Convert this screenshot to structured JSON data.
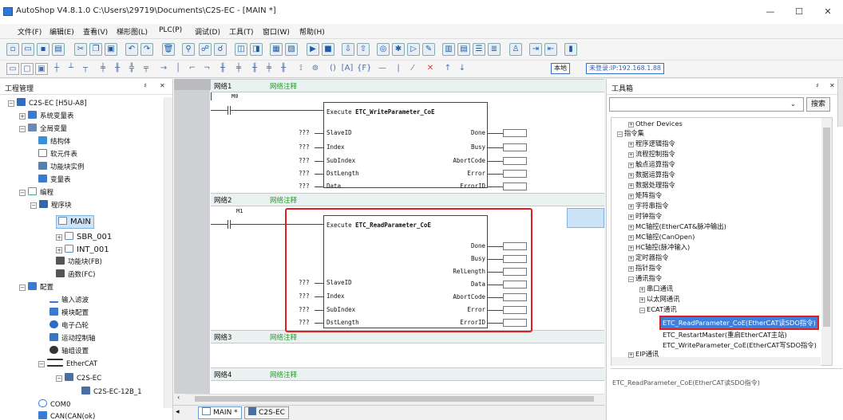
{
  "window": {
    "title": "AutoShop V4.8.1.0  C:\\Users\\29719\\Documents\\C2S-EC - [MAIN *]",
    "minimize": "—",
    "restore": "☐",
    "close": "✕"
  },
  "menu": [
    "文件(F)",
    "编辑(E)",
    "查看(V)",
    "梯形图(L)",
    "PLC(P)",
    "调试(D)",
    "工具(T)",
    "窗口(W)",
    "帮助(H)"
  ],
  "toolbar2": {
    "local_label": "本地",
    "login_label": "未登录:IP:192.168.1.88"
  },
  "project": {
    "title": "工程管理",
    "pin": "♯",
    "close": "✕",
    "items": [
      "C2S-EC [H5U-A8]",
      "系统变量表",
      "全局变量",
      "结构体",
      "软元件表",
      "功能块实例",
      "变量表",
      "编程",
      "程序块",
      "MAIN",
      "SBR_001",
      "INT_001",
      "功能块(FB)",
      "函数(FC)",
      "配置",
      "输入滤波",
      "模块配置",
      "电子凸轮",
      "运动控制轴",
      "轴组设置",
      "EtherCAT",
      "C2S-EC",
      "C2S-EC-12B_1",
      "COM0",
      "CAN(CAN(ok)"
    ]
  },
  "networks": [
    {
      "label": "网络1",
      "comment": "网络注释"
    },
    {
      "label": "网络2",
      "comment": "网络注释"
    },
    {
      "label": "网络3",
      "comment": "网络注释"
    },
    {
      "label": "网络4",
      "comment": "网络注释"
    }
  ],
  "fb1": {
    "contact": "M0",
    "execute": "Execute",
    "name": "ETC_WriteParameter_CoE",
    "inputs": [
      "SlaveID",
      "Index",
      "SubIndex",
      "DstLength",
      "Data"
    ],
    "outputs": [
      "Done",
      "Busy",
      "AbortCode",
      "Error",
      "ErrorID"
    ],
    "placeholder": "???"
  },
  "fb2": {
    "contact": "M1",
    "execute": "Execute",
    "name": "ETC_ReadParameter_CoE",
    "inputs": [
      "SlaveID",
      "Index",
      "SubIndex",
      "DstLength"
    ],
    "outputs": [
      "Done",
      "Busy",
      "RelLength",
      "Data",
      "AbortCode",
      "Error",
      "ErrorID"
    ],
    "placeholder": "???"
  },
  "toolbox": {
    "title": "工具箱",
    "pin": "♯",
    "close": "✕",
    "search_button": "搜索",
    "search_value": "",
    "items": [
      "Other Devices",
      "指令集",
      "程序逻辑指令",
      "流程控制指令",
      "触点运算指令",
      "数据运算指令",
      "数据处理指令",
      "矩阵指令",
      "字符串指令",
      "时钟指令",
      "MC轴控(EtherCAT&脉冲输出)",
      "MC轴控(CanOpen)",
      "HC轴控(脉冲输入)",
      "定时器指令",
      "指针指令",
      "通讯指令",
      "串口通讯",
      "以太网通讯",
      "ECAT通讯",
      "ETC_ReadParameter_CoE(EtherCAT读SDO指令)",
      "ETC_RestartMaster(重启EtherCAT主站)",
      "ETC_WriteParameter_CoE(EtherCAT写SDO指令)",
      "EIP通讯"
    ],
    "description": "ETC_ReadParameter_CoE(EtherCAT读SDO指令)"
  },
  "tabs": [
    "MAIN *",
    "C2S-EC"
  ],
  "colors": {
    "highlight": "#e02020",
    "comment": "#23a326",
    "selection": "#cde3f7"
  }
}
